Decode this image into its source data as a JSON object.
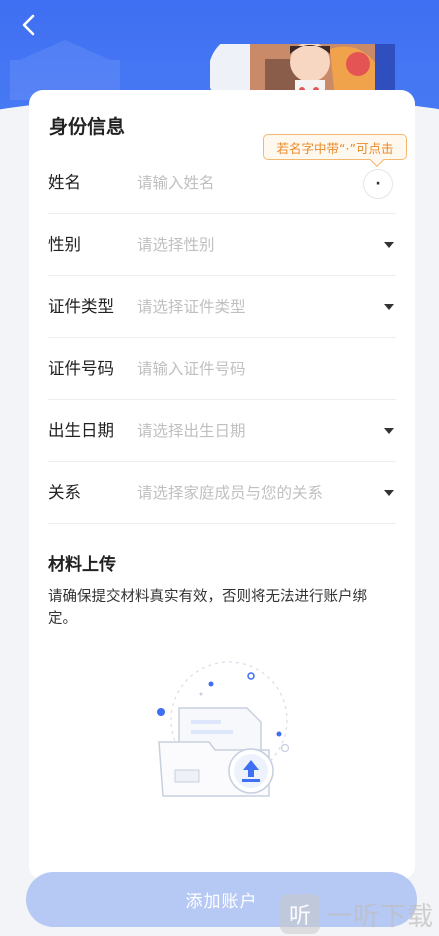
{
  "header": {
    "back_icon": "chevron-left-icon"
  },
  "identity": {
    "section_title": "身份信息",
    "tooltip": "若名字中带“·”可点击",
    "dot_button": "·",
    "fields": [
      {
        "label": "姓名",
        "placeholder": "请输入姓名"
      },
      {
        "label": "性别",
        "placeholder": "请选择性别"
      },
      {
        "label": "证件类型",
        "placeholder": "请选择证件类型"
      },
      {
        "label": "证件号码",
        "placeholder": "请输入证件号码"
      },
      {
        "label": "出生日期",
        "placeholder": "请选择出生日期"
      },
      {
        "label": "关系",
        "placeholder": "请选择家庭成员与您的关系"
      }
    ]
  },
  "upload": {
    "title": "材料上传",
    "description": "请确保提交材料真实有效，否则将无法进行账户绑定。",
    "icon": "upload-icon"
  },
  "footer": {
    "submit_label": "添加账户"
  },
  "watermark": {
    "logo_text": "听",
    "text": "一听下载"
  },
  "colors": {
    "primary": "#4a7cf4",
    "button_disabled": "#b6c8f4",
    "tooltip_orange": "#e88a2a",
    "placeholder": "#c0c0c0"
  }
}
